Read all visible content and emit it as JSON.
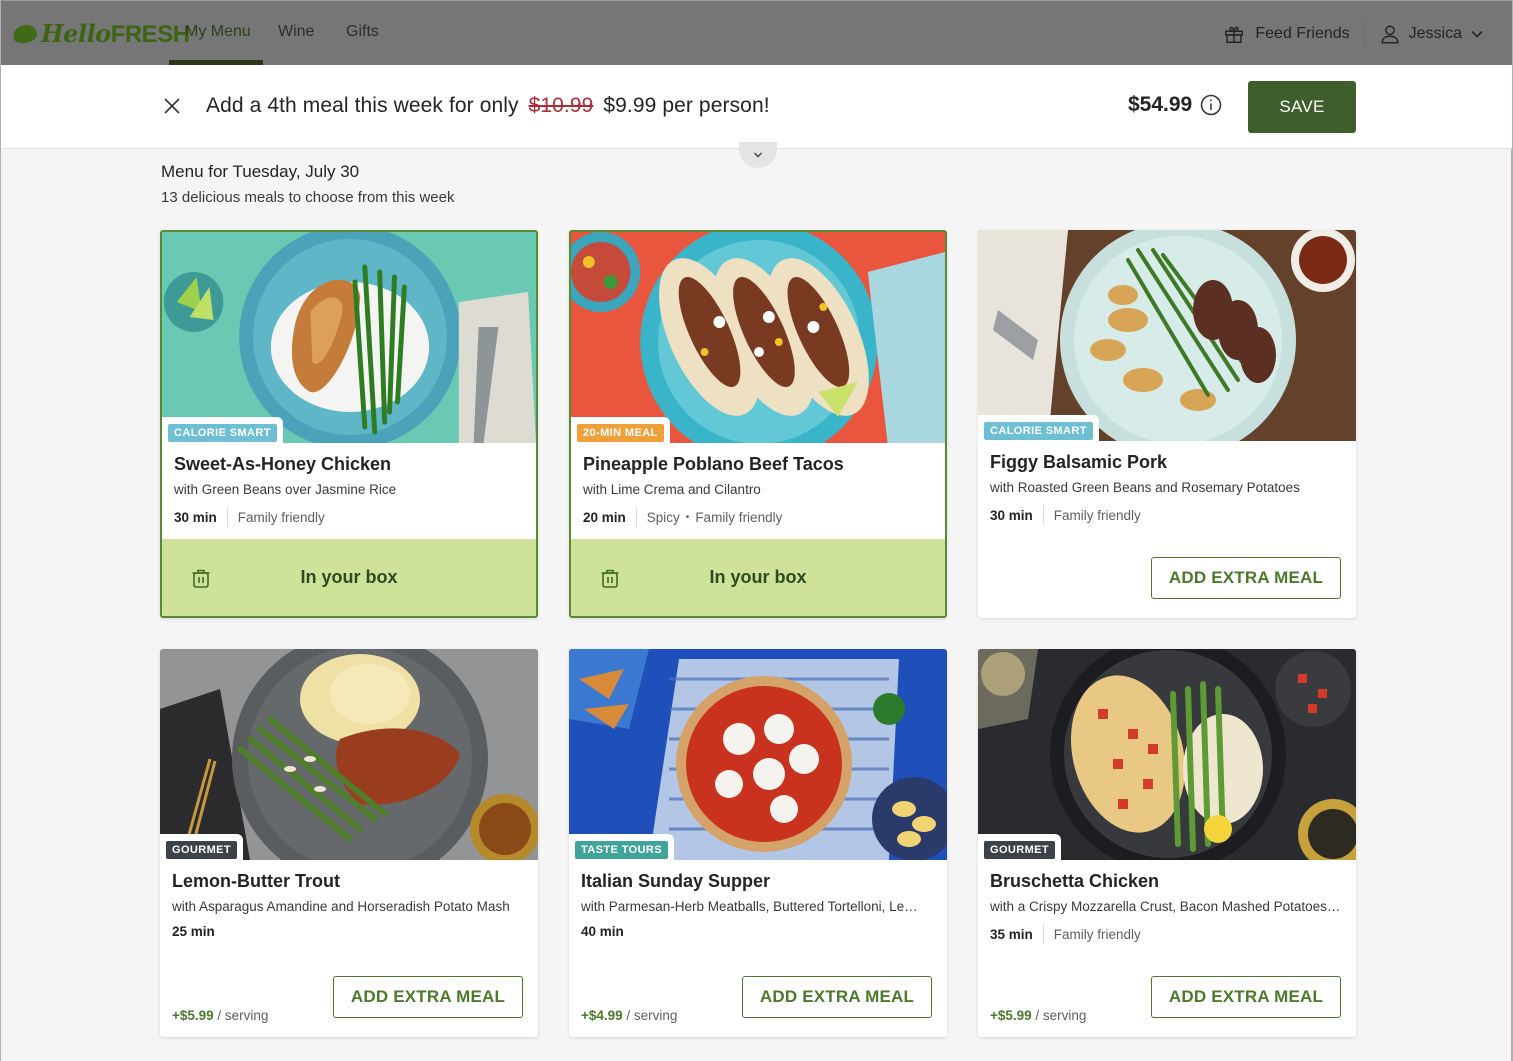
{
  "nav": {
    "brand": {
      "script": "Hello",
      "caps": "FRESH"
    },
    "items": [
      {
        "label": "My Menu",
        "active": true
      },
      {
        "label": "Wine",
        "active": false
      },
      {
        "label": "Gifts",
        "active": false
      }
    ],
    "feed_friends": "Feed Friends",
    "user_name": "Jessica"
  },
  "promo": {
    "text_prefix": "Add a 4th meal this week for only",
    "old_price": "$10.99",
    "text_suffix": "$9.99 per person!",
    "total": "$54.99",
    "save_label": "SAVE"
  },
  "menu": {
    "title": "Menu for Tuesday, July 30",
    "subtitle": "13 delicious meals to choose from this week"
  },
  "colors": {
    "brand_green": "#3e5f2c",
    "selected_bg": "#cee29a",
    "badge_calorie_smart": "#6ebfd4",
    "badge_20min": "#f0a03a",
    "badge_gourmet": "#3b424a",
    "badge_taste_tours": "#3fa59b"
  },
  "cards": [
    {
      "badge": "CALORIE SMART",
      "badge_color": "#6ebfd4",
      "title": "Sweet-As-Honey Chicken",
      "subtitle": "with Green Beans over Jasmine Rice",
      "time": "30 min",
      "tags": [
        "Family friendly"
      ],
      "in_box": true,
      "in_box_label": "In your box",
      "image_icon": "chicken-rice-green-beans-image"
    },
    {
      "badge": "20-MIN MEAL",
      "badge_color": "#f0a03a",
      "title": "Pineapple Poblano Beef Tacos",
      "subtitle": "with Lime Crema and Cilantro",
      "time": "20 min",
      "tags": [
        "Spicy",
        "Family friendly"
      ],
      "in_box": true,
      "in_box_label": "In your box",
      "image_icon": "beef-tacos-image"
    },
    {
      "badge": "CALORIE SMART",
      "badge_color": "#6ebfd4",
      "title": "Figgy Balsamic Pork",
      "subtitle": "with Roasted Green Beans and Rosemary Potatoes",
      "time": "30 min",
      "tags": [
        "Family friendly"
      ],
      "in_box": false,
      "button_label": "ADD EXTRA MEAL",
      "image_icon": "balsamic-pork-image"
    },
    {
      "badge": "GOURMET",
      "badge_color": "#3b424a",
      "title": "Lemon-Butter Trout",
      "subtitle": "with Asparagus Amandine and Horseradish Potato Mash",
      "time": "25 min",
      "tags": [],
      "in_box": false,
      "button_label": "ADD EXTRA MEAL",
      "price": "+$5.99",
      "price_unit": "/ serving",
      "image_icon": "trout-asparagus-image"
    },
    {
      "badge": "TASTE TOURS",
      "badge_color": "#3fa59b",
      "title": "Italian Sunday Supper",
      "subtitle": "with Parmesan-Herb Meatballs, Buttered Tortelloni, Le…",
      "time": "40 min",
      "tags": [],
      "in_box": false,
      "button_label": "ADD EXTRA MEAL",
      "price": "+$4.99",
      "price_unit": "/ serving",
      "image_icon": "meatballs-tortelloni-image"
    },
    {
      "badge": "GOURMET",
      "badge_color": "#3b424a",
      "title": "Bruschetta Chicken",
      "subtitle": "with a Crispy Mozzarella Crust, Bacon Mashed Potatoes…",
      "time": "35 min",
      "tags": [
        "Family friendly"
      ],
      "in_box": false,
      "button_label": "ADD EXTRA MEAL",
      "price": "+$5.99",
      "price_unit": "/ serving",
      "image_icon": "bruschetta-chicken-image"
    }
  ]
}
